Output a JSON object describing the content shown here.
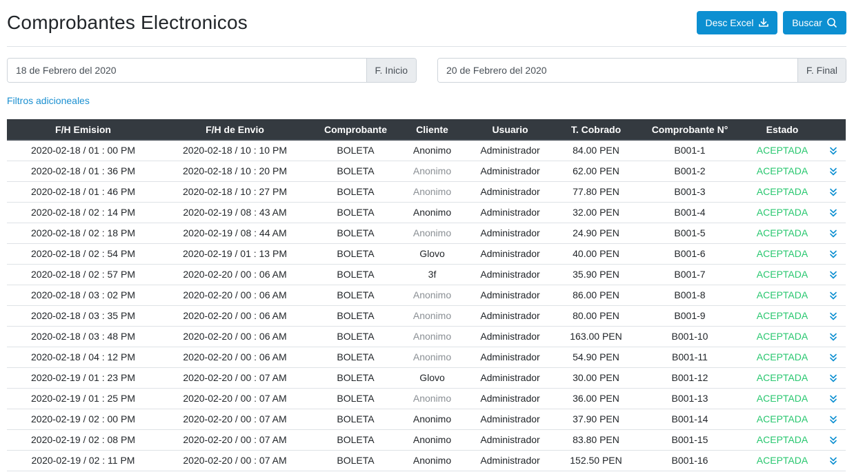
{
  "header": {
    "title": "Comprobantes Electronicos",
    "excel_label": "Desc Excel",
    "buscar_label": "Buscar"
  },
  "filters": {
    "start_value": "18 de Febrero del 2020",
    "start_addon": "F. Inicio",
    "end_value": "20 de Febrero del 2020",
    "end_addon": "F. Final",
    "additional_link": "Filtros adicioneales"
  },
  "table": {
    "columns": [
      "F/H Emision",
      "F/H de Envio",
      "Comprobante",
      "Cliente",
      "Usuario",
      "T. Cobrado",
      "Comprobante N°",
      "Estado",
      ""
    ],
    "rows": [
      {
        "emision": "2020-02-18 / 01 : 00 PM",
        "envio": "2020-02-18 / 10 : 10 PM",
        "comprobante": "BOLETA",
        "cliente": "Anonimo",
        "cliente_muted": false,
        "usuario": "Administrador",
        "cobrado": "84.00 PEN",
        "numero": "B001-1",
        "estado": "ACEPTADA"
      },
      {
        "emision": "2020-02-18 / 01 : 36 PM",
        "envio": "2020-02-18 / 10 : 20 PM",
        "comprobante": "BOLETA",
        "cliente": "Anonimo",
        "cliente_muted": true,
        "usuario": "Administrador",
        "cobrado": "62.00 PEN",
        "numero": "B001-2",
        "estado": "ACEPTADA"
      },
      {
        "emision": "2020-02-18 / 01 : 46 PM",
        "envio": "2020-02-18 / 10 : 27 PM",
        "comprobante": "BOLETA",
        "cliente": "Anonimo",
        "cliente_muted": true,
        "usuario": "Administrador",
        "cobrado": "77.80 PEN",
        "numero": "B001-3",
        "estado": "ACEPTADA"
      },
      {
        "emision": "2020-02-18 / 02 : 14 PM",
        "envio": "2020-02-19 / 08 : 43 AM",
        "comprobante": "BOLETA",
        "cliente": "Anonimo",
        "cliente_muted": false,
        "usuario": "Administrador",
        "cobrado": "32.00 PEN",
        "numero": "B001-4",
        "estado": "ACEPTADA"
      },
      {
        "emision": "2020-02-18 / 02 : 18 PM",
        "envio": "2020-02-19 / 08 : 44 AM",
        "comprobante": "BOLETA",
        "cliente": "Anonimo",
        "cliente_muted": true,
        "usuario": "Administrador",
        "cobrado": "24.90 PEN",
        "numero": "B001-5",
        "estado": "ACEPTADA"
      },
      {
        "emision": "2020-02-18 / 02 : 54 PM",
        "envio": "2020-02-19 / 01 : 13 PM",
        "comprobante": "BOLETA",
        "cliente": "Glovo",
        "cliente_muted": false,
        "usuario": "Administrador",
        "cobrado": "40.00 PEN",
        "numero": "B001-6",
        "estado": "ACEPTADA"
      },
      {
        "emision": "2020-02-18 / 02 : 57 PM",
        "envio": "2020-02-20 / 00 : 06 AM",
        "comprobante": "BOLETA",
        "cliente": "3f",
        "cliente_muted": false,
        "usuario": "Administrador",
        "cobrado": "35.90 PEN",
        "numero": "B001-7",
        "estado": "ACEPTADA"
      },
      {
        "emision": "2020-02-18 / 03 : 02 PM",
        "envio": "2020-02-20 / 00 : 06 AM",
        "comprobante": "BOLETA",
        "cliente": "Anonimo",
        "cliente_muted": true,
        "usuario": "Administrador",
        "cobrado": "86.00 PEN",
        "numero": "B001-8",
        "estado": "ACEPTADA"
      },
      {
        "emision": "2020-02-18 / 03 : 35 PM",
        "envio": "2020-02-20 / 00 : 06 AM",
        "comprobante": "BOLETA",
        "cliente": "Anonimo",
        "cliente_muted": true,
        "usuario": "Administrador",
        "cobrado": "80.00 PEN",
        "numero": "B001-9",
        "estado": "ACEPTADA"
      },
      {
        "emision": "2020-02-18 / 03 : 48 PM",
        "envio": "2020-02-20 / 00 : 06 AM",
        "comprobante": "BOLETA",
        "cliente": "Anonimo",
        "cliente_muted": true,
        "usuario": "Administrador",
        "cobrado": "163.00 PEN",
        "numero": "B001-10",
        "estado": "ACEPTADA"
      },
      {
        "emision": "2020-02-18 / 04 : 12 PM",
        "envio": "2020-02-20 / 00 : 06 AM",
        "comprobante": "BOLETA",
        "cliente": "Anonimo",
        "cliente_muted": true,
        "usuario": "Administrador",
        "cobrado": "54.90 PEN",
        "numero": "B001-11",
        "estado": "ACEPTADA"
      },
      {
        "emision": "2020-02-19 / 01 : 23 PM",
        "envio": "2020-02-20 / 00 : 07 AM",
        "comprobante": "BOLETA",
        "cliente": "Glovo",
        "cliente_muted": false,
        "usuario": "Administrador",
        "cobrado": "30.00 PEN",
        "numero": "B001-12",
        "estado": "ACEPTADA"
      },
      {
        "emision": "2020-02-19 / 01 : 25 PM",
        "envio": "2020-02-20 / 00 : 07 AM",
        "comprobante": "BOLETA",
        "cliente": "Anonimo",
        "cliente_muted": true,
        "usuario": "Administrador",
        "cobrado": "36.00 PEN",
        "numero": "B001-13",
        "estado": "ACEPTADA"
      },
      {
        "emision": "2020-02-19 / 02 : 00 PM",
        "envio": "2020-02-20 / 00 : 07 AM",
        "comprobante": "BOLETA",
        "cliente": "Anonimo",
        "cliente_muted": false,
        "usuario": "Administrador",
        "cobrado": "37.90 PEN",
        "numero": "B001-14",
        "estado": "ACEPTADA"
      },
      {
        "emision": "2020-02-19 / 02 : 08 PM",
        "envio": "2020-02-20 / 00 : 07 AM",
        "comprobante": "BOLETA",
        "cliente": "Anonimo",
        "cliente_muted": false,
        "usuario": "Administrador",
        "cobrado": "83.80 PEN",
        "numero": "B001-15",
        "estado": "ACEPTADA"
      },
      {
        "emision": "2020-02-19 / 02 : 11 PM",
        "envio": "2020-02-20 / 00 : 07 AM",
        "comprobante": "BOLETA",
        "cliente": "Anonimo",
        "cliente_muted": false,
        "usuario": "Administrador",
        "cobrado": "152.50 PEN",
        "numero": "B001-16",
        "estado": "ACEPTADA"
      }
    ]
  },
  "icons": {
    "excel": "download-icon",
    "buscar": "search-icon",
    "row_action": "chevron-double-down-icon"
  },
  "colors": {
    "primary": "#0c8fd1",
    "header_bg": "#343a40",
    "estado_ok": "#28c76f",
    "muted_text": "#8a8f94"
  }
}
